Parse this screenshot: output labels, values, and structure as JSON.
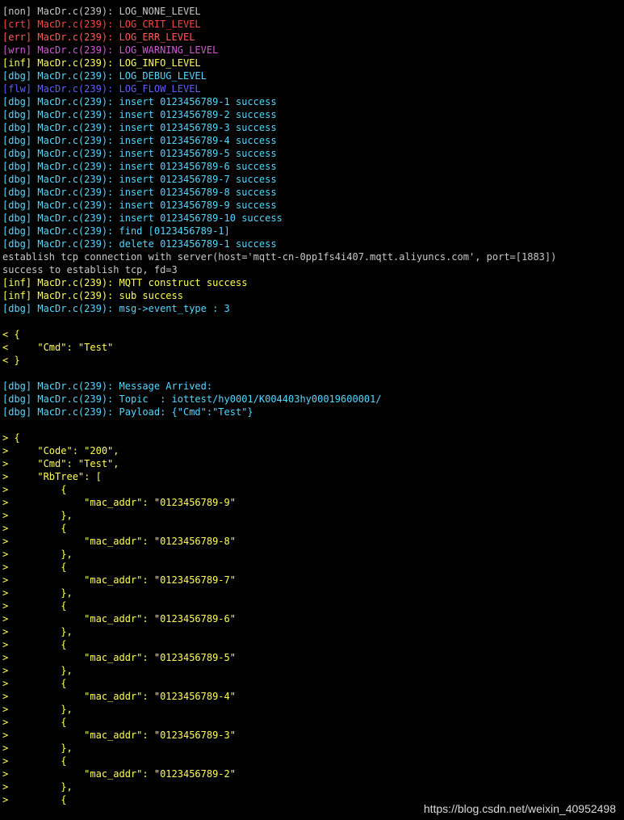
{
  "colors": {
    "non": "#c8c8c8",
    "crt": "#ff4444",
    "err": "#ff5a5a",
    "wrn": "#d35ad3",
    "inf": "#ffff55",
    "dbg": "#55d7ff",
    "flw": "#6060ff",
    "plain": "#c8c8c8",
    "background": "#000000"
  },
  "lines": [
    {
      "text": "[non] MacDr.c(239): LOG_NONE_LEVEL",
      "level": "non"
    },
    {
      "text": "[crt] MacDr.c(239): LOG_CRIT_LEVEL",
      "level": "crt"
    },
    {
      "text": "[err] MacDr.c(239): LOG_ERR_LEVEL",
      "level": "err"
    },
    {
      "text": "[wrn] MacDr.c(239): LOG_WARNING_LEVEL",
      "level": "wrn"
    },
    {
      "text": "[inf] MacDr.c(239): LOG_INFO_LEVEL",
      "level": "inf"
    },
    {
      "text": "[dbg] MacDr.c(239): LOG_DEBUG_LEVEL",
      "level": "dbg"
    },
    {
      "text": "[flw] MacDr.c(239): LOG_FLOW_LEVEL",
      "level": "flw"
    },
    {
      "text": "[dbg] MacDr.c(239): insert 0123456789-1 success",
      "level": "dbg"
    },
    {
      "text": "[dbg] MacDr.c(239): insert 0123456789-2 success",
      "level": "dbg"
    },
    {
      "text": "[dbg] MacDr.c(239): insert 0123456789-3 success",
      "level": "dbg"
    },
    {
      "text": "[dbg] MacDr.c(239): insert 0123456789-4 success",
      "level": "dbg"
    },
    {
      "text": "[dbg] MacDr.c(239): insert 0123456789-5 success",
      "level": "dbg"
    },
    {
      "text": "[dbg] MacDr.c(239): insert 0123456789-6 success",
      "level": "dbg"
    },
    {
      "text": "[dbg] MacDr.c(239): insert 0123456789-7 success",
      "level": "dbg"
    },
    {
      "text": "[dbg] MacDr.c(239): insert 0123456789-8 success",
      "level": "dbg"
    },
    {
      "text": "[dbg] MacDr.c(239): insert 0123456789-9 success",
      "level": "dbg"
    },
    {
      "text": "[dbg] MacDr.c(239): insert 0123456789-10 success",
      "level": "dbg"
    },
    {
      "text": "[dbg] MacDr.c(239): find [0123456789-1]",
      "level": "dbg"
    },
    {
      "text": "[dbg] MacDr.c(239): delete 0123456789-1 success",
      "level": "dbg"
    },
    {
      "text": "establish tcp connection with server(host='mqtt-cn-0pp1fs4i407.mqtt.aliyuncs.com', port=[1883])",
      "level": "plain"
    },
    {
      "text": "success to establish tcp, fd=3",
      "level": "plain"
    },
    {
      "text": "[inf] MacDr.c(239): MQTT construct success",
      "level": "inf"
    },
    {
      "text": "[inf] MacDr.c(239): sub success",
      "level": "inf"
    },
    {
      "text": "[dbg] MacDr.c(239): msg->event_type : 3",
      "level": "dbg"
    },
    {
      "text": "",
      "level": "plain"
    },
    {
      "text": "< {",
      "level": "inf"
    },
    {
      "text": "<     \"Cmd\": \"Test\"",
      "level": "inf"
    },
    {
      "text": "< }",
      "level": "inf"
    },
    {
      "text": "",
      "level": "plain"
    },
    {
      "text": "[dbg] MacDr.c(239): Message Arrived:",
      "level": "dbg"
    },
    {
      "text": "[dbg] MacDr.c(239): Topic  : iottest/hy0001/K004403hy00019600001/",
      "level": "dbg"
    },
    {
      "text": "[dbg] MacDr.c(239): Payload: {\"Cmd\":\"Test\"}",
      "level": "dbg"
    },
    {
      "text": "",
      "level": "plain"
    },
    {
      "text": "> {",
      "level": "inf"
    },
    {
      "text": ">     \"Code\": \"200\",",
      "level": "inf"
    },
    {
      "text": ">     \"Cmd\": \"Test\",",
      "level": "inf"
    },
    {
      "text": ">     \"RbTree\": [",
      "level": "inf"
    },
    {
      "text": ">         {",
      "level": "inf"
    },
    {
      "text": ">             \"mac_addr\": \"0123456789-9\"",
      "level": "inf"
    },
    {
      "text": ">         },",
      "level": "inf"
    },
    {
      "text": ">         {",
      "level": "inf"
    },
    {
      "text": ">             \"mac_addr\": \"0123456789-8\"",
      "level": "inf"
    },
    {
      "text": ">         },",
      "level": "inf"
    },
    {
      "text": ">         {",
      "level": "inf"
    },
    {
      "text": ">             \"mac_addr\": \"0123456789-7\"",
      "level": "inf"
    },
    {
      "text": ">         },",
      "level": "inf"
    },
    {
      "text": ">         {",
      "level": "inf"
    },
    {
      "text": ">             \"mac_addr\": \"0123456789-6\"",
      "level": "inf"
    },
    {
      "text": ">         },",
      "level": "inf"
    },
    {
      "text": ">         {",
      "level": "inf"
    },
    {
      "text": ">             \"mac_addr\": \"0123456789-5\"",
      "level": "inf"
    },
    {
      "text": ">         },",
      "level": "inf"
    },
    {
      "text": ">         {",
      "level": "inf"
    },
    {
      "text": ">             \"mac_addr\": \"0123456789-4\"",
      "level": "inf"
    },
    {
      "text": ">         },",
      "level": "inf"
    },
    {
      "text": ">         {",
      "level": "inf"
    },
    {
      "text": ">             \"mac_addr\": \"0123456789-3\"",
      "level": "inf"
    },
    {
      "text": ">         },",
      "level": "inf"
    },
    {
      "text": ">         {",
      "level": "inf"
    },
    {
      "text": ">             \"mac_addr\": \"0123456789-2\"",
      "level": "inf"
    },
    {
      "text": ">         },",
      "level": "inf"
    },
    {
      "text": ">         {",
      "level": "inf"
    }
  ],
  "watermark": "https://blog.csdn.net/weixin_40952498"
}
